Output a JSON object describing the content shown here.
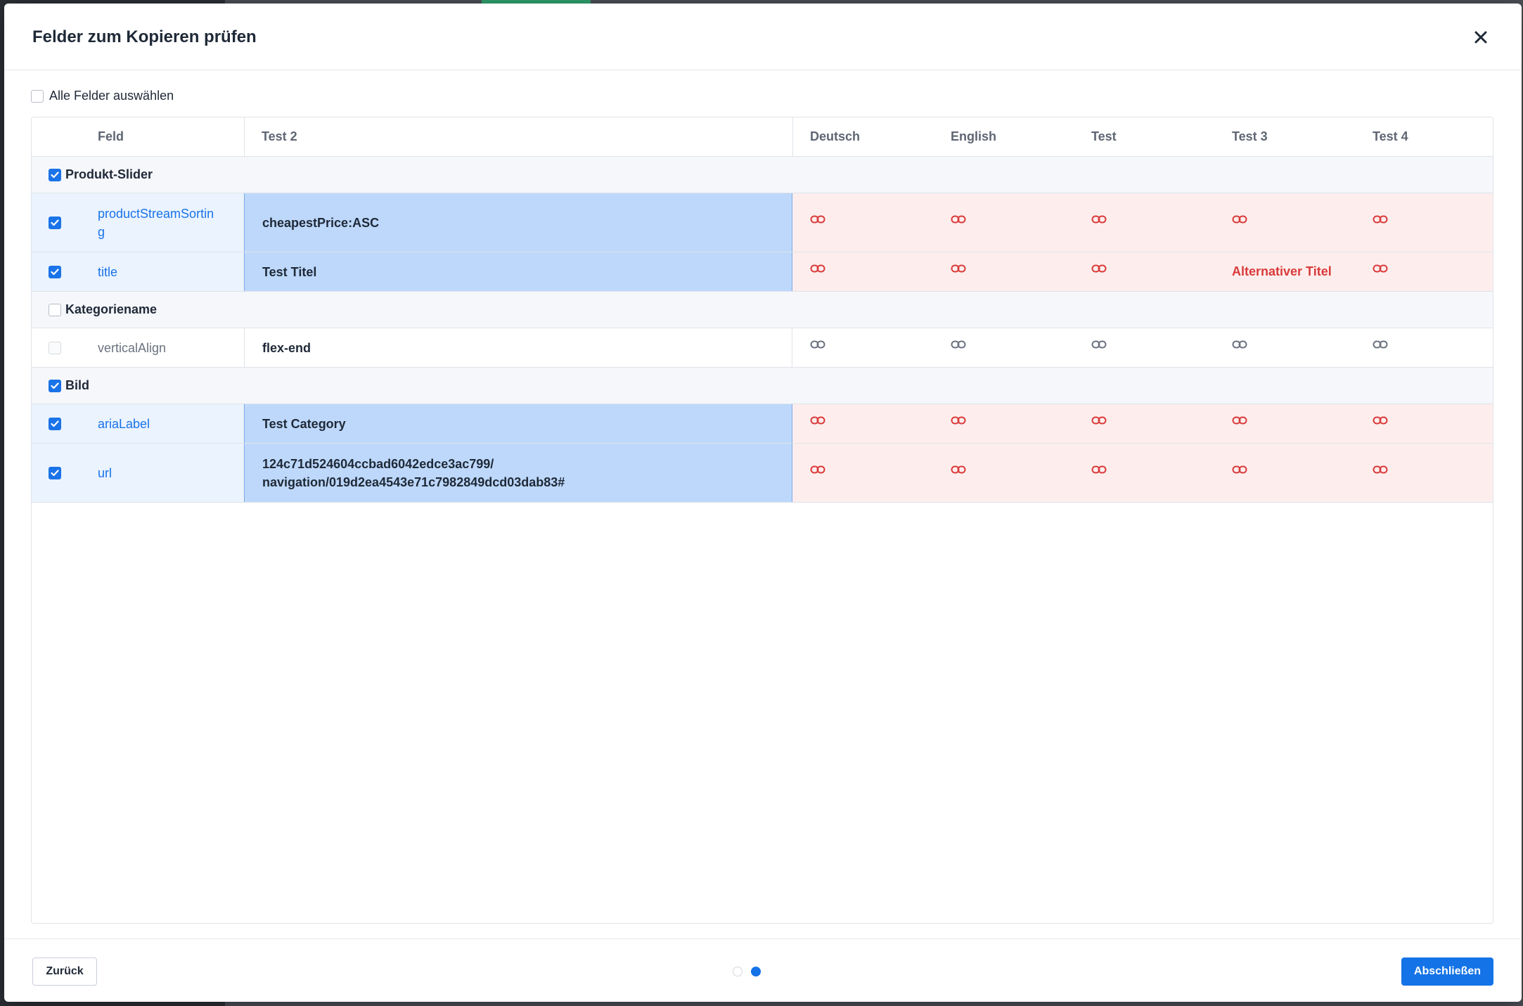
{
  "dialog": {
    "title": "Felder zum Kopieren prüfen",
    "close_icon": "close-icon",
    "select_all_label": "Alle Felder auswählen",
    "select_all_checked": false
  },
  "table": {
    "headers": {
      "field": "Feld",
      "source": "Test 2",
      "languages": [
        "Deutsch",
        "English",
        "Test",
        "Test 3",
        "Test 4"
      ]
    },
    "groups": [
      {
        "label": "Produkt-Slider",
        "checked": true,
        "rows": [
          {
            "field": "productStreamSortin\ng",
            "value": "cheapestPrice:ASC",
            "checked": true,
            "active": true,
            "cells": [
              "link",
              "link",
              "link",
              "link",
              "link"
            ]
          },
          {
            "field": "title",
            "value": "Test Titel",
            "checked": true,
            "active": true,
            "cells": [
              "link",
              "link",
              "link",
              "Alternativer Titel",
              "link"
            ]
          }
        ]
      },
      {
        "label": "Kategoriename",
        "checked": false,
        "rows": [
          {
            "field": "verticalAlign",
            "value": "flex-end",
            "checked": false,
            "active": false,
            "cells": [
              "link",
              "link",
              "link",
              "link",
              "link"
            ]
          }
        ]
      },
      {
        "label": "Bild",
        "checked": true,
        "rows": [
          {
            "field": "ariaLabel",
            "value": "Test Category",
            "checked": true,
            "active": true,
            "cells": [
              "link",
              "link",
              "link",
              "link",
              "link"
            ]
          },
          {
            "field": "url",
            "value": "124c71d524604ccbad6042edce3ac799/\nnavigation/019d2ea4543e71c7982849dcd03dab83#",
            "checked": true,
            "active": true,
            "cells": [
              "link",
              "link",
              "link",
              "link",
              "link"
            ]
          }
        ]
      }
    ]
  },
  "footer": {
    "back_label": "Zurück",
    "finish_label": "Abschließen",
    "steps": 2,
    "current_step": 2
  },
  "colors": {
    "accent": "#1473e6",
    "link_active": "#d93a3a",
    "link_inactive": "#6b7280"
  }
}
